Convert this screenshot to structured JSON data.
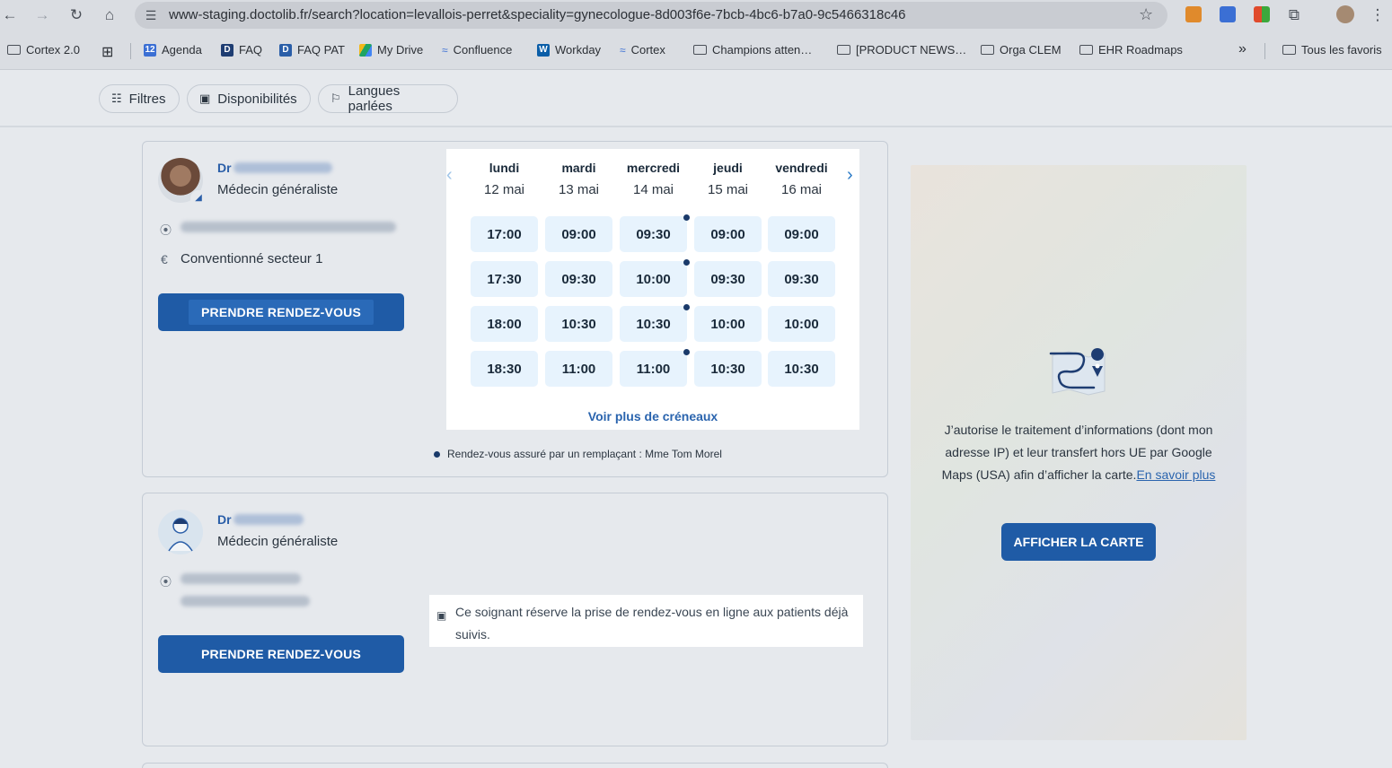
{
  "browser": {
    "url": "www-staging.doctolib.fr/search?location=levallois-perret&speciality=gynecologue-8d003f6e-7bcb-4bc6-b7a0-9c5466318c46",
    "bookmarks": [
      {
        "label": "Cortex 2.0",
        "icon": "gear-icon"
      },
      {
        "label": "Agenda",
        "icon": "calendar-icon",
        "badge": "12"
      },
      {
        "label": "FAQ",
        "icon": "doctolib-icon",
        "badge": "D"
      },
      {
        "label": "FAQ PAT",
        "icon": "doctolib-icon",
        "badge": "D"
      },
      {
        "label": "My Drive",
        "icon": "drive-icon"
      },
      {
        "label": "Confluence",
        "icon": "confluence-icon"
      },
      {
        "label": "Workday",
        "icon": "workday-icon",
        "badge": "W"
      },
      {
        "label": "Cortex",
        "icon": "confluence-icon"
      },
      {
        "label": "Champions atten…",
        "icon": "folder-icon"
      },
      {
        "label": "[PRODUCT NEWS…",
        "icon": "folder-icon"
      },
      {
        "label": "Orga CLEM",
        "icon": "folder-icon"
      },
      {
        "label": "EHR Roadmaps",
        "icon": "folder-icon"
      }
    ],
    "overflow_label": "»",
    "all_bookmarks_label": "Tous les favoris"
  },
  "filters": {
    "filters_label": "Filtres",
    "availability_label": "Disponibilités",
    "languages_label": "Langues parlées"
  },
  "card1": {
    "dr_prefix": "Dr",
    "specialty": "Médecin généraliste",
    "sector": "Conventionné secteur 1",
    "book_label": "PRENDRE RENDEZ-VOUS",
    "days": [
      {
        "name": "lundi",
        "date": "12 mai"
      },
      {
        "name": "mardi",
        "date": "13 mai"
      },
      {
        "name": "mercredi",
        "date": "14 mai"
      },
      {
        "name": "jeudi",
        "date": "15 mai"
      },
      {
        "name": "vendredi",
        "date": "16 mai"
      }
    ],
    "slots": [
      [
        "17:00",
        "17:30",
        "18:00",
        "18:30"
      ],
      [
        "09:00",
        "09:30",
        "10:30",
        "11:00"
      ],
      [
        "09:30",
        "10:00",
        "10:30",
        "11:00"
      ],
      [
        "09:00",
        "09:30",
        "10:00",
        "10:30"
      ],
      [
        "09:00",
        "09:30",
        "10:00",
        "10:30"
      ]
    ],
    "more_slots_label": "Voir plus de créneaux",
    "replacement_note": "Rendez-vous assuré par un remplaçant : Mme Tom Morel"
  },
  "card2": {
    "dr_prefix": "Dr",
    "specialty": "Médecin généraliste",
    "book_label": "PRENDRE RENDEZ-VOUS",
    "info": "Ce soignant réserve la prise de rendez-vous en ligne aux patients déjà suivis."
  },
  "map": {
    "consent_text": "J’autorise le traitement d’informations (dont mon adresse IP) et leur transfert hors UE par Google Maps (USA) afin d’afficher la carte.",
    "learn_more_label": "En savoir plus",
    "show_map_label": "AFFICHER LA CARTE"
  },
  "colors": {
    "primary": "#1f5ba6",
    "slot_bg": "#e7f3fd",
    "link": "#2a64ae"
  }
}
